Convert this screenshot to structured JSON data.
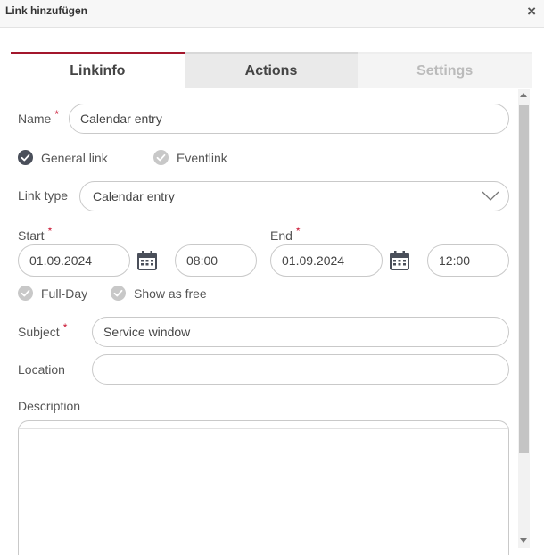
{
  "dialog": {
    "title": "Link hinzufügen",
    "close_glyph": "×"
  },
  "tabs": [
    {
      "label": "Linkinfo",
      "state": "active"
    },
    {
      "label": "Actions",
      "state": "inactive"
    },
    {
      "label": "Settings",
      "state": "disabled"
    }
  ],
  "form": {
    "name": {
      "label": "Name",
      "required_mark": "*",
      "value": "Calendar entry"
    },
    "link_kind": {
      "options": [
        {
          "label": "General link",
          "selected": true
        },
        {
          "label": "Eventlink",
          "selected": false
        }
      ]
    },
    "link_type": {
      "label": "Link type",
      "value": "Calendar entry"
    },
    "start": {
      "label": "Start",
      "required_mark": "*",
      "date": "01.09.2024",
      "time": "08:00"
    },
    "end": {
      "label": "End",
      "required_mark": "*",
      "date": "01.09.2024",
      "time": "12:00"
    },
    "flags": [
      {
        "label": "Full-Day",
        "checked": false
      },
      {
        "label": "Show as free",
        "checked": false
      }
    ],
    "subject": {
      "label": "Subject",
      "required_mark": "*",
      "value": "Service window"
    },
    "location": {
      "label": "Location",
      "value": ""
    },
    "description": {
      "label": "Description",
      "value": ""
    }
  },
  "colors": {
    "accent": "#a3172c",
    "checked": "#4a4f5a",
    "unchecked": "#c8c8c8",
    "required": "#c8102e"
  },
  "icons": {
    "calendar": "calendar-icon",
    "dropdown": "chevron-down-icon",
    "check": "check-icon"
  }
}
